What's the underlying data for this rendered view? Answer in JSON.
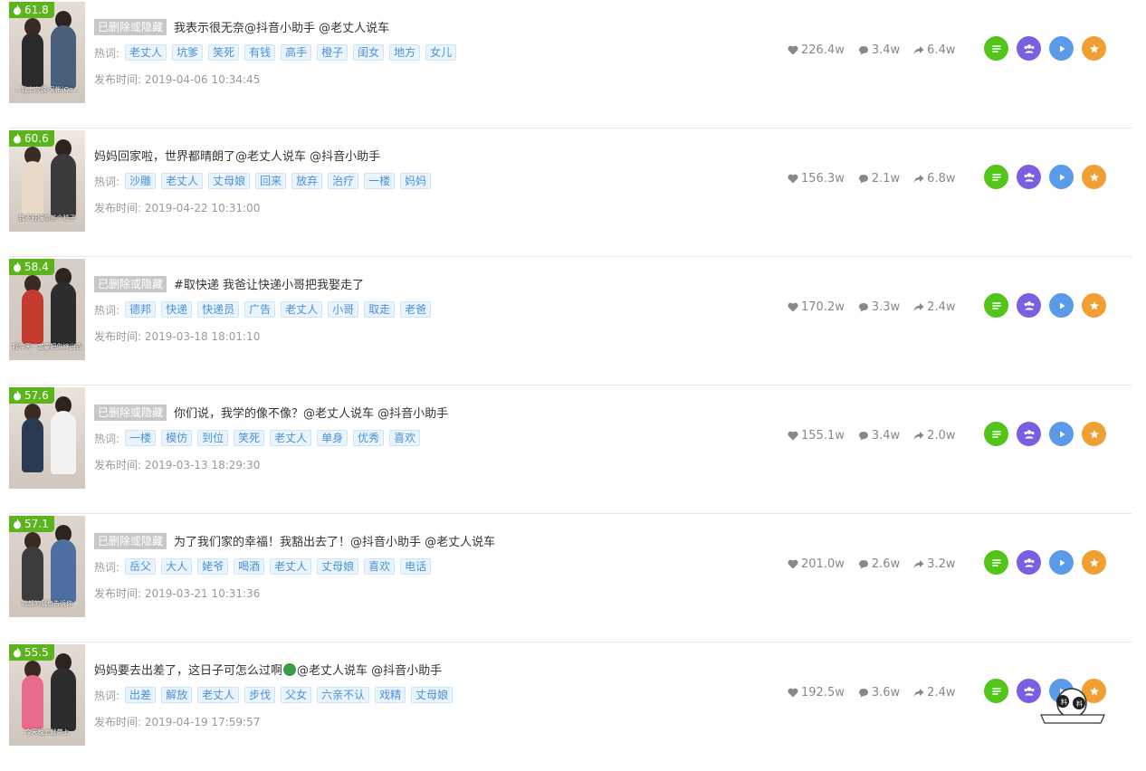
{
  "labels": {
    "hot_words": "热词:",
    "publish_time": "发布时间:",
    "deleted": "已删除或隐藏"
  },
  "colors": {
    "score_bg": "#5bb41d",
    "tag_text": "#4a90d9",
    "detail": "#52c41a",
    "fans": "#7b5fe0",
    "play": "#5b9ae8",
    "collect": "#f0a032"
  },
  "icons": {
    "score": "flame-icon",
    "likes": "heart-icon",
    "comments": "comment-icon",
    "shares": "share-icon",
    "detail": "list-icon",
    "fans": "users-icon",
    "play": "play-icon",
    "collect": "star-icon"
  },
  "videos": [
    {
      "score": "61.8",
      "deleted": true,
      "title": "我表示很无奈@抖音小助手 @老丈人说车",
      "tags": [
        "老丈人",
        "坑爹",
        "笑死",
        "有钱",
        "高手",
        "橙子",
        "闺女",
        "地方",
        "女儿"
      ],
      "time": "2019-04-06 10:34:45",
      "likes": "226.4w",
      "comments": "3.4w",
      "shares": "6.4w",
      "thumb_caption": "…我上次说·又帐(Qo…",
      "thumb_colors": [
        "#e6ded6",
        "#2b2b2b",
        "#4a5f7c"
      ]
    },
    {
      "score": "60.6",
      "deleted": false,
      "title": "妈妈回家啦，世界都晴朗了@老丈人说车 @抖音小助手",
      "tags": [
        "沙雕",
        "老丈人",
        "丈母娘",
        "回来",
        "放弃",
        "治疗",
        "一楼",
        "妈妈"
      ],
      "time": "2019-04-22 10:31:00",
      "likes": "156.3w",
      "comments": "2.1w",
      "shares": "6.8w",
      "thumb_caption": "我不舒服你盖个毯子",
      "thumb_colors": [
        "#efe8e0",
        "#e8d9c8",
        "#3b3b3b"
      ]
    },
    {
      "score": "58.4",
      "deleted": true,
      "title": "#取快递 我爸让快递小哥把我娶走了",
      "tags": [
        "德邦",
        "快递",
        "快递员",
        "广告",
        "老丈人",
        "小哥",
        "取走",
        "老爸"
      ],
      "time": "2019-03-18 18:01:10",
      "likes": "170.2w",
      "comments": "3.3w",
      "shares": "2.4w",
      "thumb_caption": "我今天一定要把你嫁出去",
      "thumb_colors": [
        "#d8cfc6",
        "#c23b2e",
        "#2d2d2d"
      ]
    },
    {
      "score": "57.6",
      "deleted": true,
      "title": "你们说，我学的像不像？@老丈人说车 @抖音小助手",
      "tags": [
        "一楼",
        "模仿",
        "到位",
        "笑死",
        "老丈人",
        "单身",
        "优秀",
        "喜欢"
      ],
      "time": "2019-03-13 18:29:30",
      "likes": "155.1w",
      "comments": "3.4w",
      "shares": "2.0w",
      "thumb_caption": "",
      "thumb_colors": [
        "#e9e3dc",
        "#2a3a52",
        "#f2f2f2"
      ]
    },
    {
      "score": "57.1",
      "deleted": true,
      "title": "为了我们家的幸福！我豁出去了！@抖音小助手 @老丈人说车",
      "tags": [
        "岳父",
        "大人",
        "姥爷",
        "喝酒",
        "老丈人",
        "丈母娘",
        "喜欢",
        "电话"
      ],
      "time": "2019-03-21 10:31:36",
      "likes": "201.0w",
      "comments": "2.6w",
      "shares": "3.2w",
      "thumb_caption": "姓叔的我也告诉你",
      "thumb_colors": [
        "#ddd5ce",
        "#3c3c3c",
        "#4f6fa3"
      ]
    },
    {
      "score": "55.5",
      "deleted": false,
      "title_before": "妈妈要去出差了，这日子可怎么过啊",
      "title_after": "@老丈人说车 @抖音小助手",
      "tags": [
        "出差",
        "解放",
        "老丈人",
        "步伐",
        "父女",
        "六亲不认",
        "戏精",
        "丈母娘"
      ],
      "time": "2019-04-19 17:59:57",
      "likes": "192.5w",
      "comments": "3.6w",
      "shares": "2.4w",
      "thumb_caption": "今天晚上就带上",
      "thumb_colors": [
        "#e4dcd4",
        "#e86a8c",
        "#2c2c2c"
      ]
    }
  ]
}
